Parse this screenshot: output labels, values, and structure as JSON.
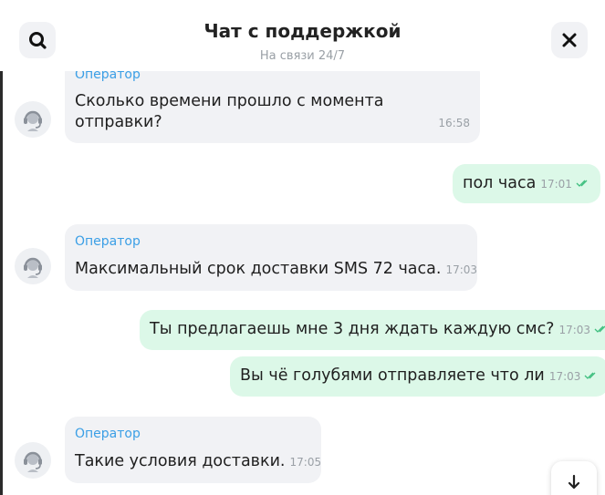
{
  "header": {
    "title": "Чат с поддержкой",
    "subtitle": "На связи 24/7",
    "search_icon": "search-icon",
    "close_icon": "close-icon"
  },
  "colors": {
    "incoming_bubble": "#f1f2f5",
    "outgoing_bubble": "#dcf8e8",
    "sender_name": "#3b9fe6",
    "read_ticks": "#3fbf7f"
  },
  "messages": [
    {
      "direction": "in",
      "sender": "Оператор",
      "text_line1": "Сколько времени прошло с момента",
      "text_line2": "отправки?",
      "time": "16:58"
    },
    {
      "direction": "out",
      "text": "пол часа",
      "time": "17:01",
      "status_icon": "double-check-icon"
    },
    {
      "direction": "in",
      "sender": "Оператор",
      "text": "Максимальный срок доставки SMS 72 часа.",
      "time": "17:03"
    },
    {
      "direction": "out",
      "text": "Ты предлагаешь мне 3 дня ждать каждую смс?",
      "time": "17:03",
      "status_icon": "double-check-icon"
    },
    {
      "direction": "out",
      "text": "Вы чё голубями отправляете что ли",
      "time": "17:03",
      "status_icon": "double-check-icon"
    },
    {
      "direction": "in",
      "sender": "Оператор",
      "text": "Такие условия доставки.",
      "time": "17:05"
    }
  ],
  "scroll_down_icon": "arrow-down-icon",
  "operator_avatar_icon": "operator-headset-icon"
}
